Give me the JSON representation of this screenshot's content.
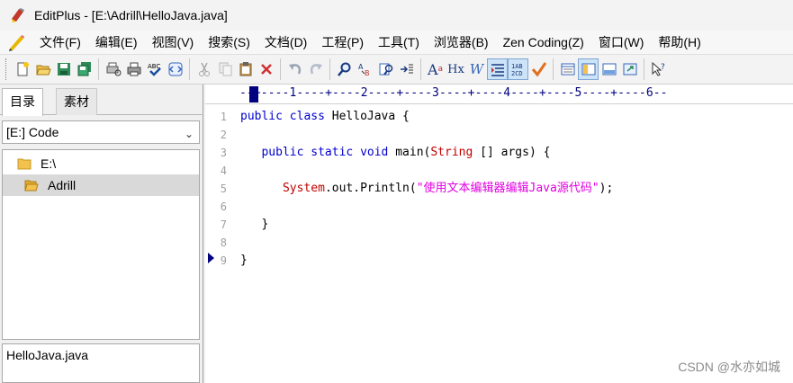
{
  "window": {
    "title": "EditPlus - [E:\\Adrill\\HelloJava.java]"
  },
  "menu": {
    "items": [
      "文件(F)",
      "编辑(E)",
      "视图(V)",
      "搜索(S)",
      "文档(D)",
      "工程(P)",
      "工具(T)",
      "浏览器(B)",
      "Zen Coding(Z)",
      "窗口(W)",
      "帮助(H)"
    ]
  },
  "toolbar": {
    "buttons": [
      "new-file",
      "open",
      "save",
      "save-all",
      "print-preview",
      "print",
      "spell-check",
      "browser-preview",
      "cut",
      "copy",
      "paste",
      "delete",
      "undo",
      "redo",
      "find",
      "replace",
      "find-in-files",
      "goto",
      "font",
      "hx",
      "word-wrap",
      "indent",
      "line-numbers",
      "check",
      "toggle-panel",
      "directory-window",
      "output-window",
      "full-screen",
      "help"
    ],
    "font_label": "A",
    "hx_label": "Hx",
    "wrap_label": "W",
    "lineno_label": "1AB\n2CD"
  },
  "sidebar": {
    "tabs": [
      "目录",
      "素材"
    ],
    "drive": "[E:] Code",
    "tree": [
      {
        "label": "E:\\",
        "selected": false
      },
      {
        "label": "Adrill",
        "selected": true
      }
    ],
    "files": [
      "HelloJava.java"
    ]
  },
  "editor": {
    "ruler": "--+----1----+----2----+----3----+----4----+----5----+----6--",
    "line_numbers": [
      "1",
      "2",
      "3",
      "4",
      "5",
      "6",
      "7",
      "8",
      "9"
    ],
    "lines": [
      {
        "tokens": [
          {
            "t": "public",
            "c": "kw"
          },
          {
            "t": " ",
            "c": "plain"
          },
          {
            "t": "class",
            "c": "kw"
          },
          {
            "t": " HelloJava {",
            "c": "plain"
          }
        ]
      },
      {
        "tokens": []
      },
      {
        "tokens": [
          {
            "t": "   ",
            "c": "plain"
          },
          {
            "t": "public",
            "c": "kw"
          },
          {
            "t": " ",
            "c": "plain"
          },
          {
            "t": "static",
            "c": "kw"
          },
          {
            "t": " ",
            "c": "plain"
          },
          {
            "t": "void",
            "c": "kw"
          },
          {
            "t": " main(",
            "c": "plain"
          },
          {
            "t": "String",
            "c": "ty"
          },
          {
            "t": " [] args) {",
            "c": "plain"
          }
        ]
      },
      {
        "tokens": []
      },
      {
        "tokens": [
          {
            "t": "      ",
            "c": "plain"
          },
          {
            "t": "System",
            "c": "ty"
          },
          {
            "t": ".out.Println(",
            "c": "plain"
          },
          {
            "t": "\"使用文本编辑器编辑Java源代码\"",
            "c": "str"
          },
          {
            "t": ");",
            "c": "plain"
          }
        ]
      },
      {
        "tokens": []
      },
      {
        "tokens": [
          {
            "t": "   }",
            "c": "plain"
          }
        ]
      },
      {
        "tokens": []
      },
      {
        "tokens": [
          {
            "t": "}",
            "c": "plain"
          }
        ]
      }
    ]
  },
  "watermark": "CSDN @水亦如城",
  "colors": {
    "keyword": "#0000d0",
    "type": "#c00000",
    "string": "#e000e0",
    "ruler": "#000080"
  }
}
